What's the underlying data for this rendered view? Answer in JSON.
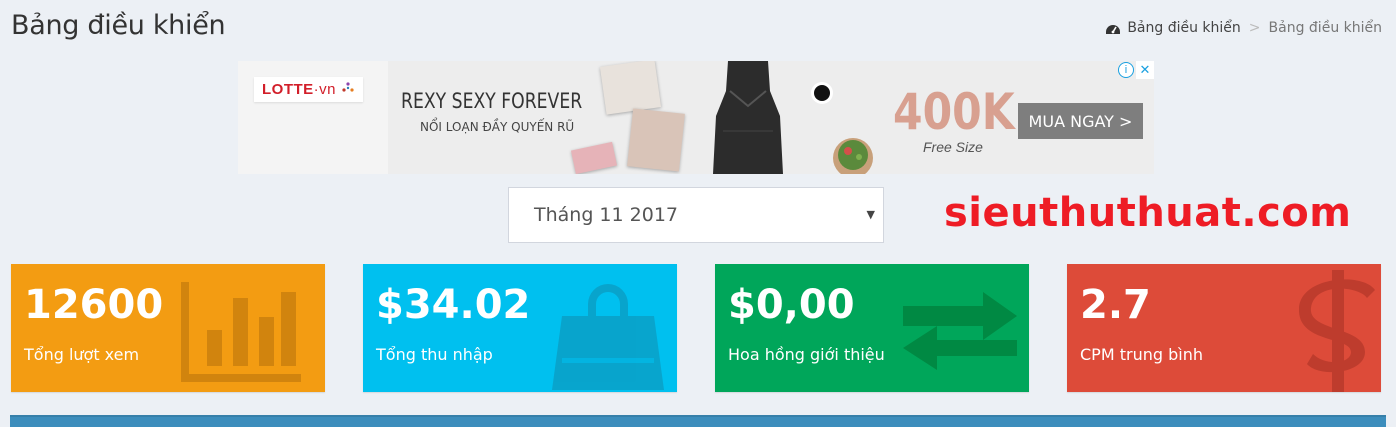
{
  "header": {
    "title": "Bảng điều khiển",
    "breadcrumb": {
      "home": "Bảng điều khiển",
      "separator": ">",
      "current": "Bảng điều khiển"
    }
  },
  "ad": {
    "brand": "LOTTE",
    "brand_suffix": "·vn",
    "headline": "REXY SEXY FOREVER",
    "subline": "NỔI LOẠN ĐẦY QUYẾN RŨ",
    "price": "400K",
    "price_sub": "Free Size",
    "cta": "MUA NGAY >",
    "info_icon": "i",
    "close_icon": "✕"
  },
  "filter": {
    "month": "Tháng 11 2017"
  },
  "watermark": "sieuthuthuat.com",
  "stats": [
    {
      "value": "12600",
      "label": "Tổng lượt xem",
      "icon": "bar-chart-icon",
      "color": "#f39c12"
    },
    {
      "value": "$34.02",
      "label": "Tổng thu nhập",
      "icon": "shopping-bag-icon",
      "color": "#00c0ef"
    },
    {
      "value": "$0,00",
      "label": "Hoa hồng giới thiệu",
      "icon": "exchange-arrows-icon",
      "color": "#00a65a"
    },
    {
      "value": "2.7",
      "label": "CPM trung bình",
      "icon": "dollar-icon",
      "color": "#dd4b39"
    }
  ]
}
